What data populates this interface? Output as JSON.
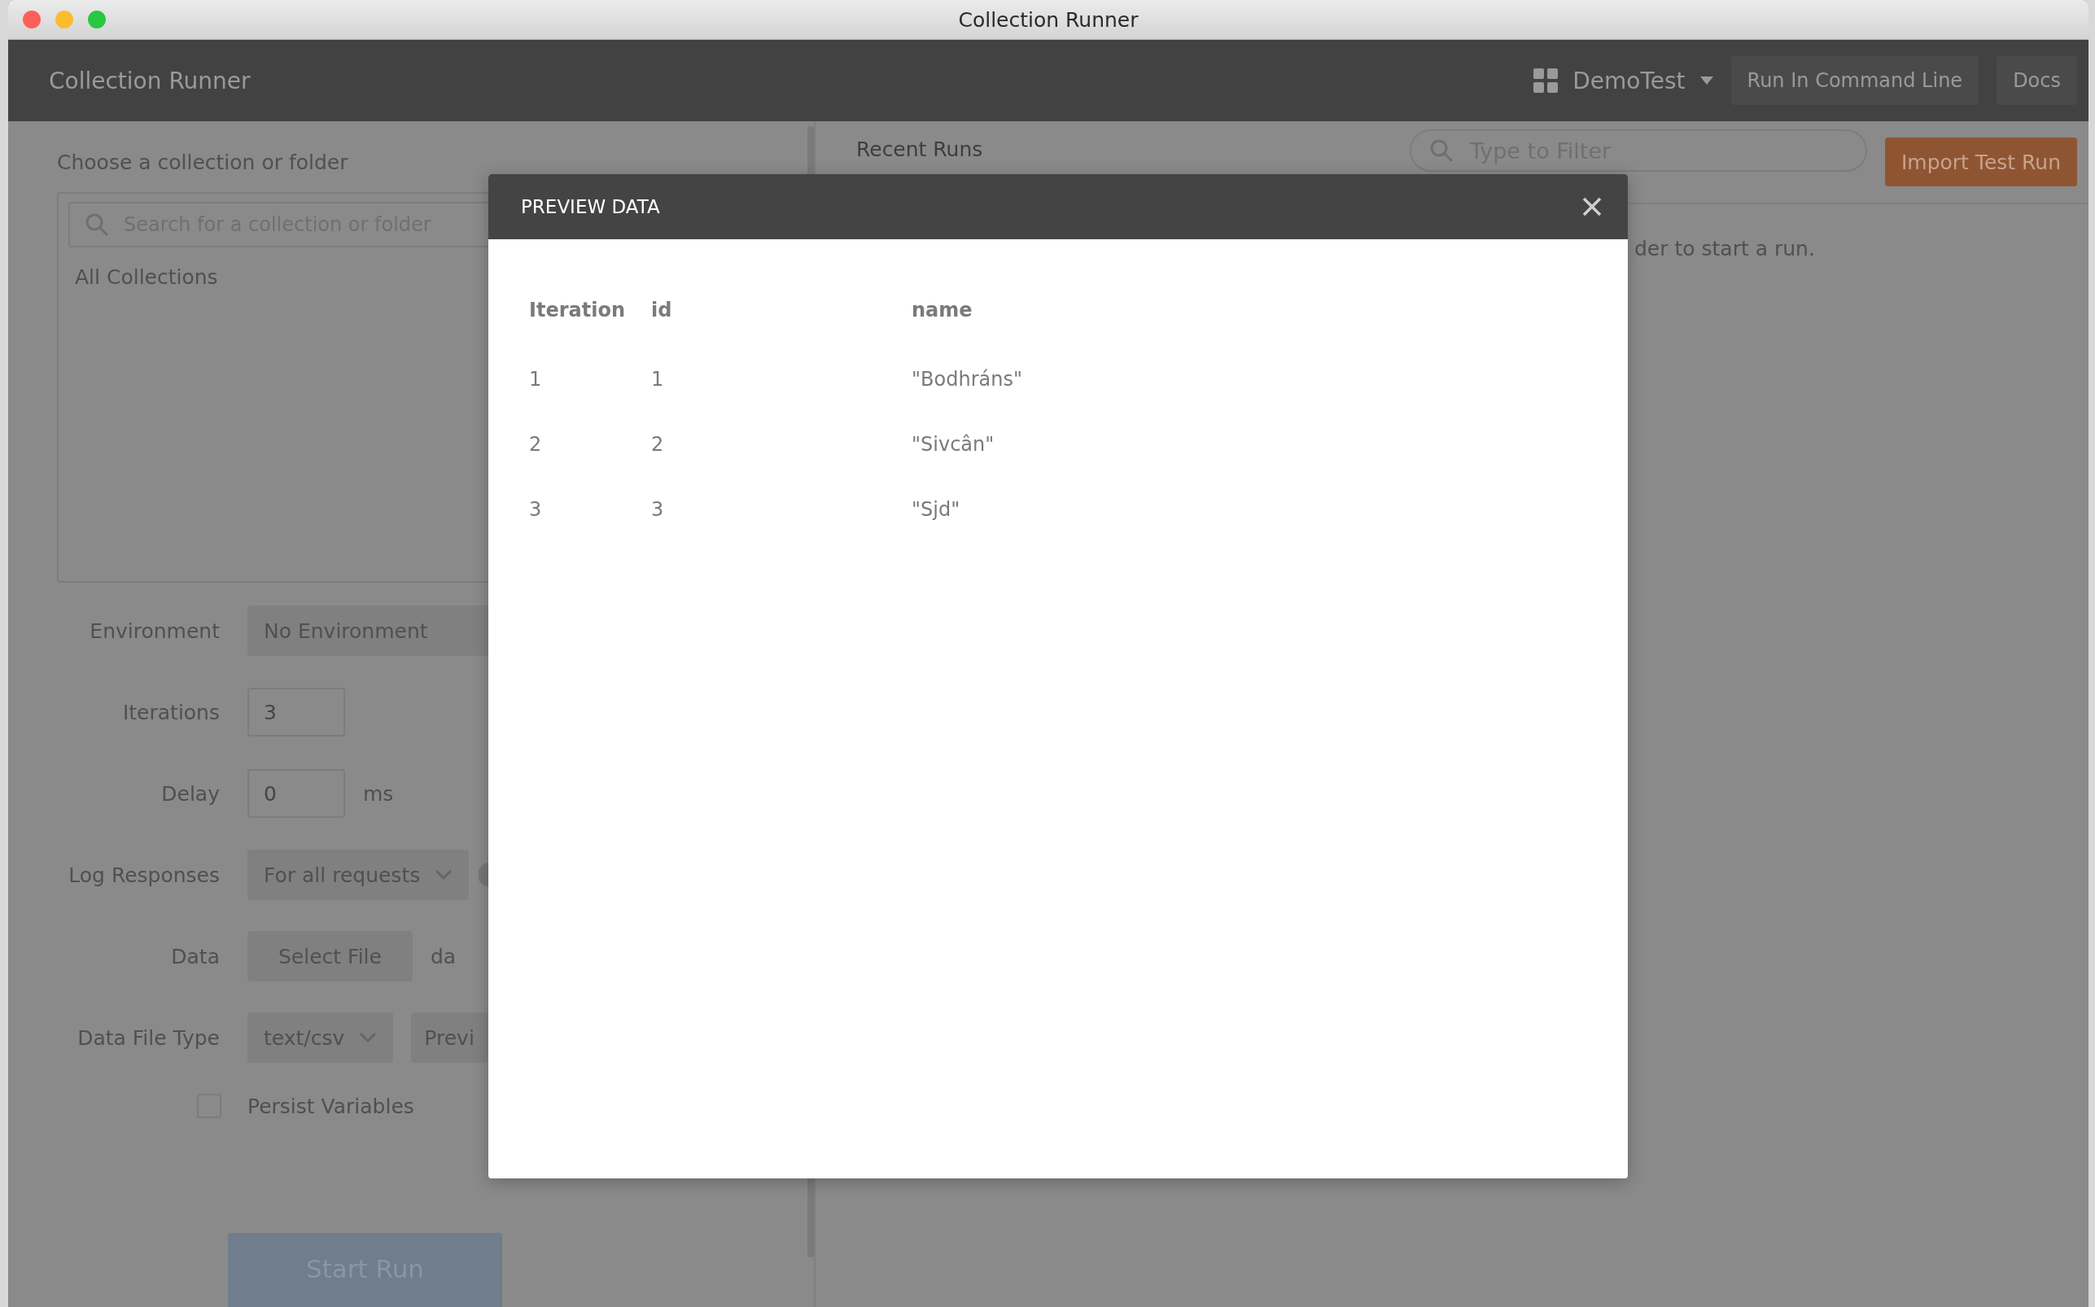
{
  "window": {
    "title": "Collection Runner"
  },
  "header": {
    "title": "Collection Runner",
    "workspace": "DemoTest",
    "buttons": [
      "Run In Command Line",
      "Docs"
    ]
  },
  "left_panel": {
    "heading": "Choose a collection or folder",
    "search": {
      "placeholder": "Search for a collection or folder"
    },
    "collections_label": "All Collections",
    "form": [
      {
        "kind": "select",
        "label": "Environment",
        "value": "No Environment"
      },
      {
        "kind": "input",
        "label": "Iterations",
        "value": "3"
      },
      {
        "kind": "input",
        "label": "Delay",
        "value": "0",
        "unit": "ms"
      },
      {
        "kind": "dropdown",
        "label": "Log Responses",
        "value": "For all requests"
      },
      {
        "kind": "file",
        "label": "Data",
        "button": "Select File",
        "note": "da"
      },
      {
        "kind": "dropdown",
        "label": "Data File Type",
        "value": "text/csv",
        "button": "Previ"
      }
    ],
    "persist_variables": {
      "label": "Persist Variables",
      "checked": false
    },
    "start_button": {
      "label": "Start Run",
      "disabled": true
    }
  },
  "right_panel": {
    "heading": "Recent Runs",
    "filter": {
      "placeholder": "Type to Filter"
    },
    "import_button": "Import Test Run",
    "message": "der to start a run."
  },
  "modal": {
    "title": "PREVIEW DATA",
    "columns": [
      "Iteration",
      "id",
      "name"
    ],
    "rows": [
      [
        "1",
        "1",
        "\"Bodhráns\""
      ],
      [
        "2",
        "2",
        "\"Sivcân\""
      ],
      [
        "3",
        "3",
        "\"Sjd\""
      ]
    ]
  }
}
